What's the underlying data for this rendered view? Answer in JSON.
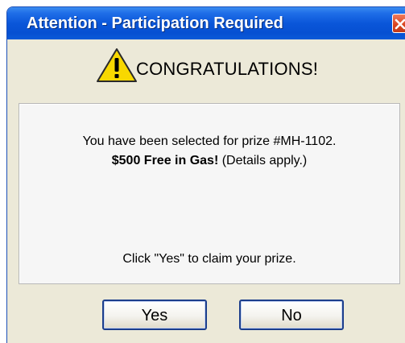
{
  "dialog": {
    "title": "Attention - Participation Required",
    "heading": "CONGRATULATIONS!",
    "message_line1": "You have been selected for prize #MH-1102.",
    "message_line2_bold": "$500 Free in Gas!",
    "message_line2_rest": " (Details apply.)",
    "message_line3": "Click \"Yes\" to claim your prize.",
    "yes_label": "Yes",
    "no_label": "No",
    "close_icon": "close-icon",
    "warning_icon": "warning-icon"
  },
  "colors": {
    "titlebar": "#0650d2",
    "close_button": "#d8431e",
    "window_background": "#ece9d8",
    "warning_fill": "#f8d800"
  }
}
